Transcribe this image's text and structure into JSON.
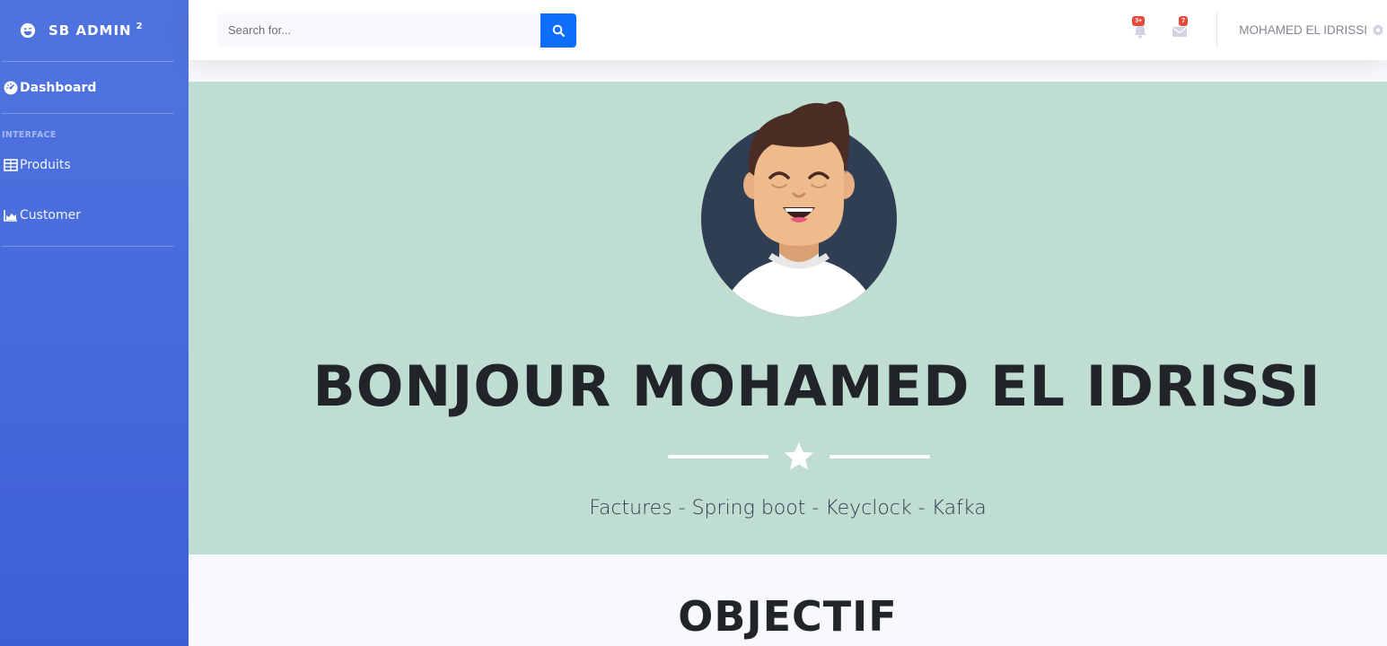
{
  "brand": {
    "name": "SB ADMIN",
    "sup": "2",
    "icon": "laugh-wink-icon"
  },
  "sidebar": {
    "dashboard": {
      "label": "Dashboard",
      "icon": "tachometer-icon"
    },
    "heading": "INTERFACE",
    "items": [
      {
        "label": "Produits",
        "icon": "table-icon"
      },
      {
        "label": "Customer",
        "icon": "area-chart-icon"
      }
    ]
  },
  "search": {
    "placeholder": "Search for..."
  },
  "topbar": {
    "alerts_badge": "3+",
    "messages_badge": "7",
    "user_name": "MOHAMED EL IDRISSI"
  },
  "hero": {
    "title": "BONJOUR MOHAMED EL IDRISSI",
    "subtitle": "Factures - Spring boot - Keyclock - Kafka"
  },
  "objective": {
    "title": "OBJECTIF"
  },
  "colors": {
    "sidebar": "#4e73df",
    "hero_bg": "#c0ddd2",
    "search_button": "#0d6efd",
    "badge": "#e74a3b"
  }
}
